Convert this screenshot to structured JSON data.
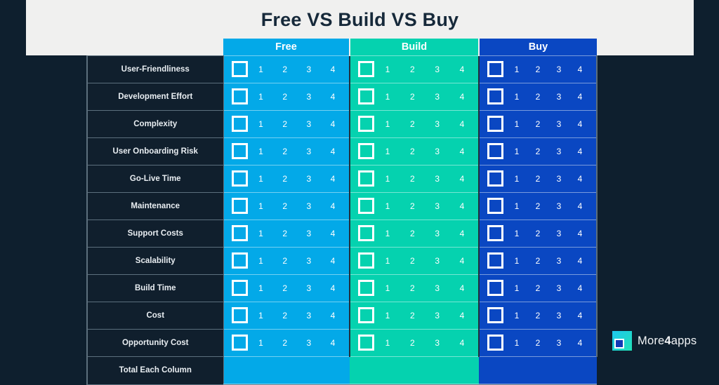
{
  "header": {
    "title": "Free VS Build VS Buy"
  },
  "table": {
    "columns": [
      {
        "label": "Free",
        "color": "#03a9e8"
      },
      {
        "label": "Build",
        "color": "#05d2af"
      },
      {
        "label": "Buy",
        "color": "#0a47c2"
      }
    ],
    "scale": [
      "1",
      "2",
      "3",
      "4"
    ],
    "rows": [
      {
        "label": "User-Friendliness"
      },
      {
        "label": "Development Effort"
      },
      {
        "label": "Complexity"
      },
      {
        "label": "User Onboarding Risk"
      },
      {
        "label": "Go-Live Time"
      },
      {
        "label": "Maintenance"
      },
      {
        "label": "Support Costs"
      },
      {
        "label": "Scalability"
      },
      {
        "label": "Build Time"
      },
      {
        "label": "Cost"
      },
      {
        "label": "Opportunity Cost"
      }
    ],
    "total_row": {
      "label": "Total Each Column",
      "values": [
        "",
        "",
        ""
      ]
    }
  },
  "brand": {
    "name_prefix": "More",
    "name_accent": "4",
    "name_suffix": "apps",
    "mark": "more4apps-logo-icon"
  },
  "colors": {
    "page_background": "#0e1f2e",
    "title_band": "#f0f0ef",
    "title_text": "#16293a",
    "label_cell": "#101f2d",
    "grid_line": "#5c6f7d"
  }
}
